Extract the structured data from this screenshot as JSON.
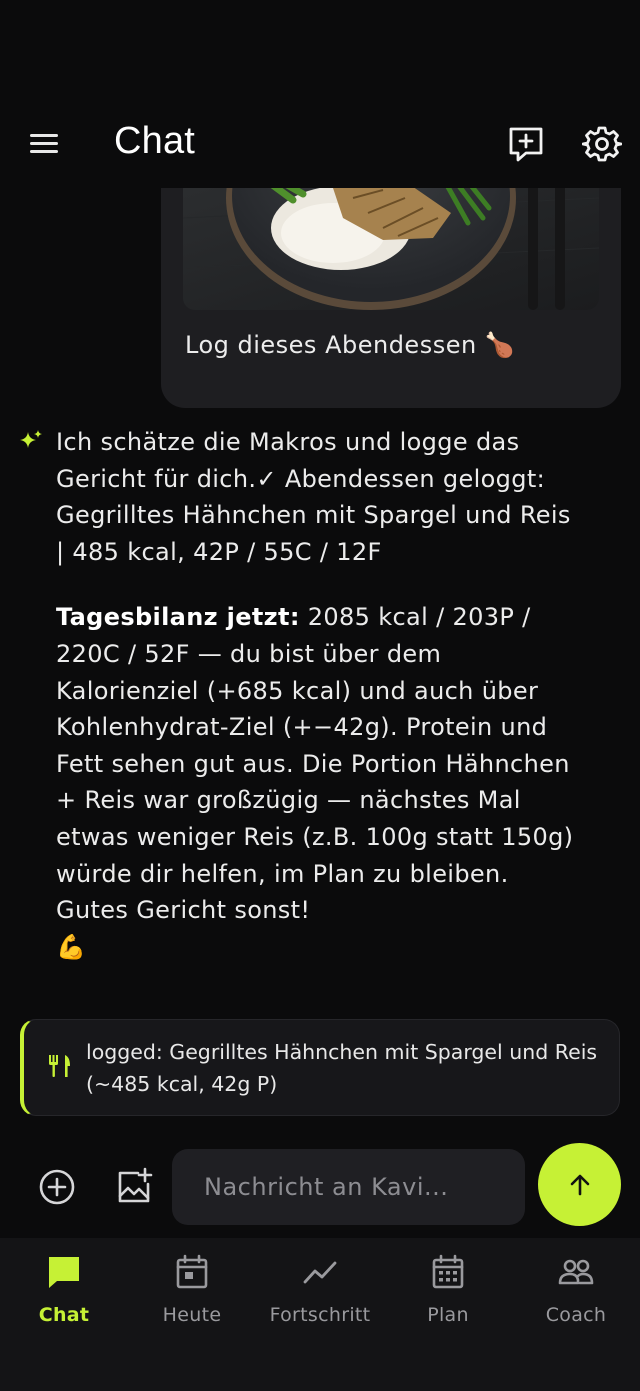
{
  "header": {
    "title": "Chat",
    "menu_icon": "hamburger-menu-icon",
    "new_chat_icon": "new-chat-icon",
    "settings_icon": "gear-icon"
  },
  "user_message": {
    "text": "Log dieses Abendessen 🍗",
    "image": "photo of grilled chicken with rice and green beans on a dark plate"
  },
  "assistant_message": {
    "icon": "sparkle-icon",
    "paragraph1": "Ich schätze die Makros und logge das Gericht für dich.✓ Abendessen geloggt: Gegrilltes Hähnchen mit Spargel und Reis | 485 kcal, 42P / 55C / 12F",
    "paragraph2_bold": "Tagesbilanz jetzt:",
    "paragraph2_rest": " 2085 kcal / 203P / 220C / 52F — du bist über dem Kalorienziel (+685 kcal) und auch über Kohlenhydrat-Ziel (+−42g). Protein und Fett sehen gut aus. Die Portion Hähnchen + Reis war großzügig — nächstes Mal etwas weniger Reis (z.B. 100g statt 150g) würde dir helfen, im Plan zu bleiben. Gutes Gericht sonst!",
    "paragraph2_emoji": "💪"
  },
  "log_card": {
    "icon": "fork-knife-icon",
    "text": "logged: Gegrilltes Hähnchen mit Spargel und Reis (~485 kcal, 42g P)"
  },
  "composer": {
    "placeholder": "Nachricht an Kavi...",
    "value": "",
    "add_icon": "plus-circle-icon",
    "image_icon": "add-image-icon",
    "send_icon": "arrow-up-icon"
  },
  "nav": {
    "items": [
      {
        "label": "Chat",
        "icon": "chat-bubble-icon",
        "active": true
      },
      {
        "label": "Heute",
        "icon": "calendar-day-icon",
        "active": false
      },
      {
        "label": "Fortschritt",
        "icon": "trend-line-icon",
        "active": false
      },
      {
        "label": "Plan",
        "icon": "calendar-grid-icon",
        "active": false
      },
      {
        "label": "Coach",
        "icon": "people-icon",
        "active": false
      }
    ]
  },
  "colors": {
    "background": "#0b0b0c",
    "accent": "#c6f135",
    "surface": "#1e1e21",
    "muted_text": "#9a9a9e"
  }
}
